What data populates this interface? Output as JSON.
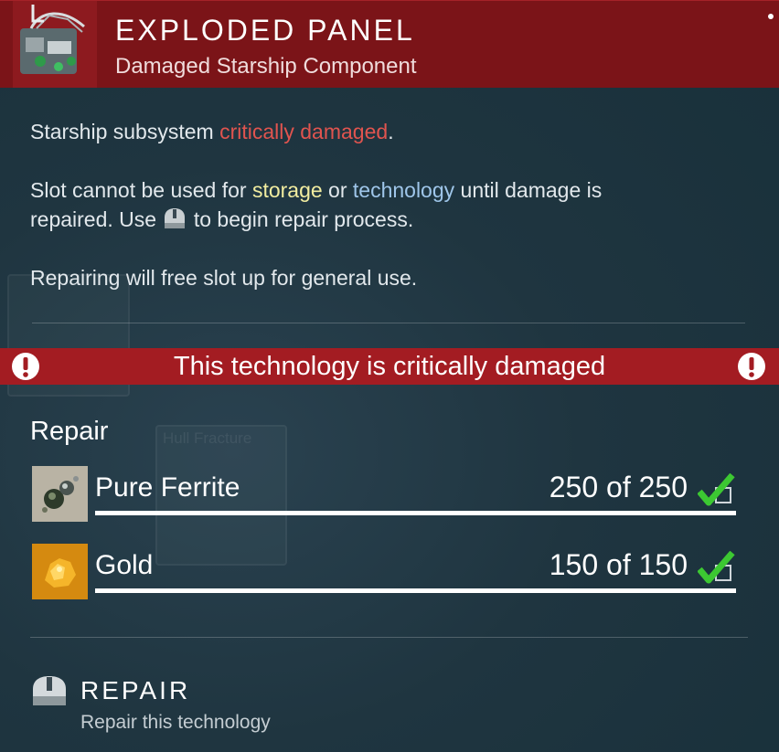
{
  "header": {
    "title": "EXPLODED PANEL",
    "subtitle": "Damaged Starship Component",
    "thumbnail_icon": "exploded-panel-icon"
  },
  "description": {
    "line1_prefix": "Starship subsystem ",
    "line1_highlight": "critically damaged",
    "line1_suffix": ".",
    "line2_a": "Slot cannot be used for ",
    "line2_storage": "storage",
    "line2_b": " or ",
    "line2_technology": "technology",
    "line2_c": " until damage is",
    "line3_a": "repaired. Use ",
    "line3_icon": "mouse-button-icon",
    "line3_b": " to begin repair process.",
    "line4": "Repairing will free slot up for general use."
  },
  "banner": {
    "text": "This technology is critically damaged",
    "icon": "exclamation-icon",
    "color": "#a31c22"
  },
  "repair": {
    "title": "Repair",
    "items": [
      {
        "name": "Pure Ferrite",
        "count": "250 of 250",
        "icon": "pure-ferrite-icon",
        "complete": true
      },
      {
        "name": "Gold",
        "count": "150 of 150",
        "icon": "gold-icon",
        "complete": true
      }
    ]
  },
  "action": {
    "label": "REPAIR",
    "description": "Repair this technology",
    "icon": "mouse-button-icon"
  },
  "colors": {
    "header": "#7b1418",
    "highlight_red": "#e0544f",
    "highlight_yellow": "#f2eda0",
    "highlight_blue": "#9fc6ea",
    "check_green": "#3cc832"
  }
}
